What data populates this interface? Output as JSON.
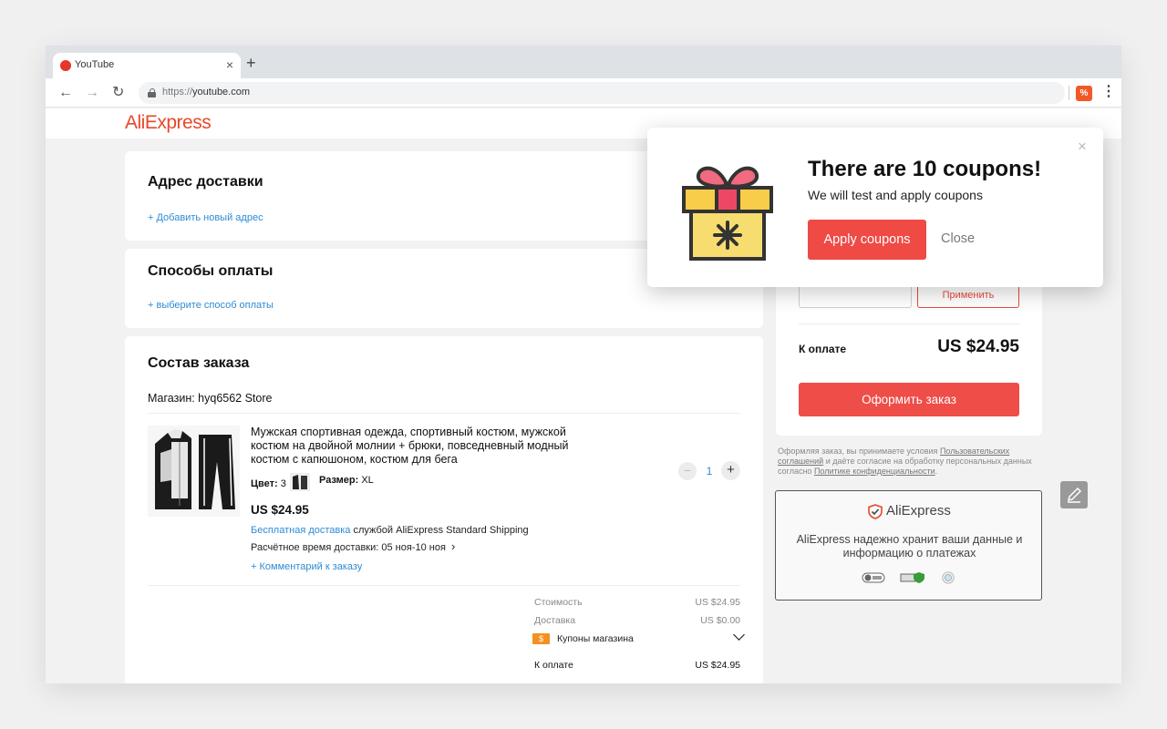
{
  "browser": {
    "tab_title": "YouTube",
    "tab_close": "×",
    "new_tab": "+",
    "url_scheme": "https://",
    "url_host": "youtube.com",
    "back": "←",
    "forward": "→",
    "reload": "↻",
    "menu": "⋮",
    "ext_label": "%"
  },
  "site": {
    "logo_part1": "Ali",
    "logo_part2": "Express"
  },
  "delivery": {
    "title": "Адрес доставки",
    "add_link": "+ Добавить новый адрес"
  },
  "payment": {
    "title": "Способы оплаты",
    "select_link": "+ выберите способ оплаты"
  },
  "order": {
    "title": "Состав заказа",
    "store": "Магазин: hyq6562 Store",
    "product_title": "Мужская спортивная одежда, спортивный костюм, мужской костюм на двойной молнии + брюки, повседневный модный костюм с капюшоном, костюм для бега",
    "color_label": "Цвет:",
    "color_value": "3",
    "size_label": "Размер:",
    "size_value": "XL",
    "price": "US $24.95",
    "free_shipping": "Бесплатная доставка",
    "shipping_service": "службой AliExpress Standard Shipping",
    "eta_label": "Расчётное время доставки:",
    "eta_value": "05 ноя-10 ноя",
    "eta_chevron": "›",
    "comment_link": "+ Комментарий к заказу",
    "qty_minus": "−",
    "qty": "1",
    "qty_plus": "+",
    "summary": {
      "cost_label": "Стоимость",
      "cost_value": "US $24.95",
      "shipping_label": "Доставка",
      "shipping_value": "US $0.00",
      "coupon_badge": "$",
      "coupons_label": "Купоны магазина",
      "total_label": "К оплате",
      "total_value": "US $24.95"
    }
  },
  "sidebar": {
    "apply_button": "Применить",
    "pay_label": "К оплате",
    "pay_total": "US $24.95",
    "checkout_button": "Оформить заказ",
    "legal_prefix": "Оформляя заказ, вы принимаете условия",
    "legal_link1": "Пользовательских соглашений",
    "legal_middle": "и даёте согласие на обработку персональных данных согласно",
    "legal_link2": "Политике конфиденциальности",
    "legal_suffix": "."
  },
  "secure": {
    "logo": "AliExpress",
    "text": "AliExpress надежно хранит ваши данные и информацию о платежах"
  },
  "popup": {
    "title": "There are 10 coupons!",
    "subtitle": "We will test and apply coupons",
    "apply_button": "Apply coupons",
    "close_button": "Close",
    "close_x": "×"
  },
  "colors": {
    "accent_red": "#f04a45",
    "link_blue": "#2e8bd4",
    "logo_red": "#e8482a",
    "logo_orange": "#f29d1f"
  }
}
